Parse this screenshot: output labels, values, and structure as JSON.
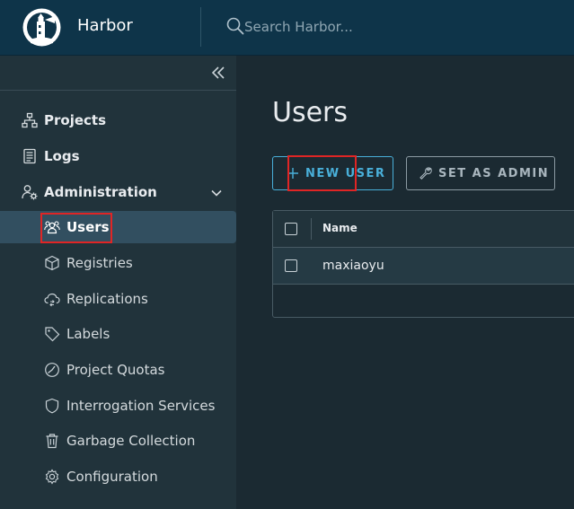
{
  "header": {
    "app_title": "Harbor",
    "search_placeholder": "Search Harbor..."
  },
  "sidebar": {
    "items": [
      {
        "label": "Projects",
        "icon": "projects-icon"
      },
      {
        "label": "Logs",
        "icon": "logs-icon"
      },
      {
        "label": "Administration",
        "icon": "administration-icon",
        "expanded": true
      }
    ],
    "admin_items": [
      {
        "label": "Users",
        "icon": "users-icon",
        "active": true
      },
      {
        "label": "Registries",
        "icon": "registries-icon"
      },
      {
        "label": "Replications",
        "icon": "replications-icon"
      },
      {
        "label": "Labels",
        "icon": "labels-icon"
      },
      {
        "label": "Project Quotas",
        "icon": "project-quotas-icon"
      },
      {
        "label": "Interrogation Services",
        "icon": "interrogation-services-icon"
      },
      {
        "label": "Garbage Collection",
        "icon": "garbage-collection-icon"
      },
      {
        "label": "Configuration",
        "icon": "configuration-icon"
      }
    ]
  },
  "main": {
    "page_title": "Users",
    "new_user_label": "NEW USER",
    "set_admin_label": "SET AS ADMIN",
    "grid": {
      "columns": [
        "Name"
      ],
      "rows": [
        {
          "name": "maxiaoyu"
        }
      ]
    }
  },
  "colors": {
    "header_bg": "#0e3449",
    "sidebar_bg": "#21333b",
    "main_bg": "#1b2a32",
    "active_item_bg": "#324f60",
    "accent": "#49afd9",
    "highlight": "#e02525"
  }
}
